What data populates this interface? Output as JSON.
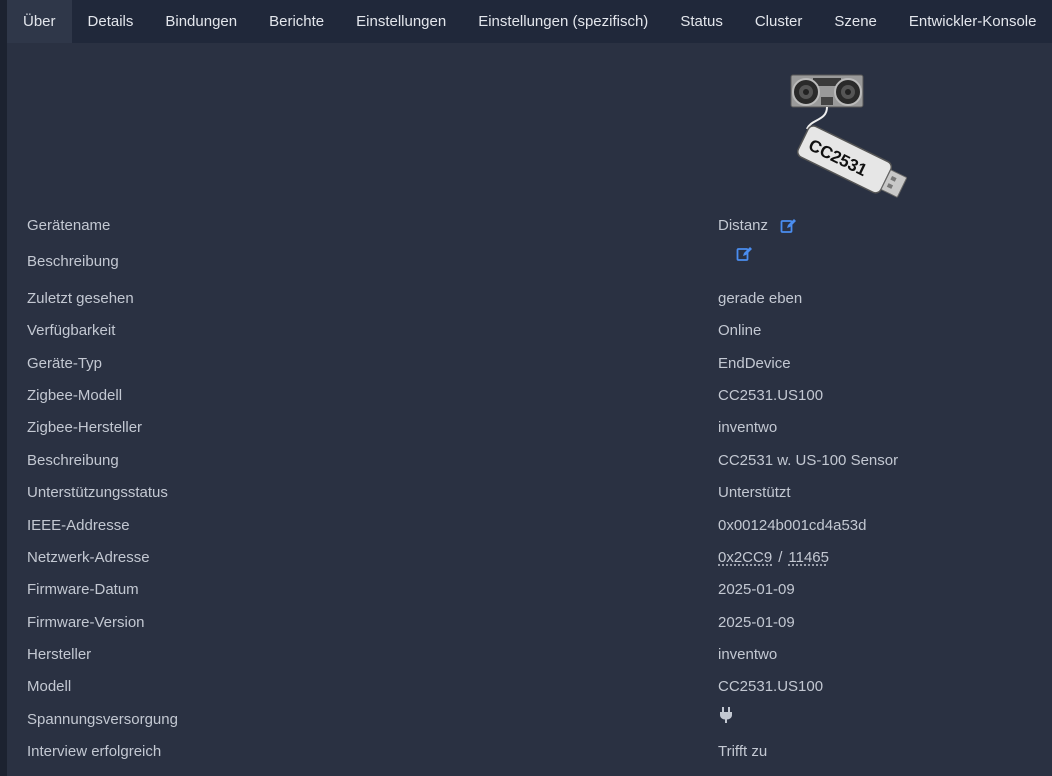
{
  "tabs": [
    {
      "label": "Über",
      "active": true
    },
    {
      "label": "Details"
    },
    {
      "label": "Bindungen"
    },
    {
      "label": "Berichte"
    },
    {
      "label": "Einstellungen"
    },
    {
      "label": "Einstellungen (spezifisch)"
    },
    {
      "label": "Status"
    },
    {
      "label": "Cluster"
    },
    {
      "label": "Szene"
    },
    {
      "label": "Entwickler-Konsole"
    }
  ],
  "device_image": {
    "label_text": "CC2531"
  },
  "rows": {
    "device_name": {
      "label": "Gerätename",
      "value": "Distanz"
    },
    "description_edit": {
      "label": "Beschreibung",
      "value": ""
    },
    "last_seen": {
      "label": "Zuletzt gesehen",
      "value": "gerade eben"
    },
    "availability": {
      "label": "Verfügbarkeit",
      "value": "Online"
    },
    "device_type": {
      "label": "Geräte-Typ",
      "value": "EndDevice"
    },
    "zigbee_model": {
      "label": "Zigbee-Modell",
      "value": "CC2531.US100"
    },
    "zigbee_manufacturer": {
      "label": "Zigbee-Hersteller",
      "value": "inventwo"
    },
    "description": {
      "label": "Beschreibung",
      "value": "CC2531 w. US-100 Sensor"
    },
    "support_status": {
      "label": "Unterstützungsstatus",
      "value": "Unterstützt"
    },
    "ieee_address": {
      "label": "IEEE-Addresse",
      "value": "0x00124b001cd4a53d"
    },
    "network_address": {
      "label": "Netzwerk-Adresse",
      "hex": "0x2CC9",
      "separator": "/",
      "dec": "11465"
    },
    "firmware_date": {
      "label": "Firmware-Datum",
      "value": "2025-01-09"
    },
    "firmware_version": {
      "label": "Firmware-Version",
      "value": "2025-01-09"
    },
    "manufacturer": {
      "label": "Hersteller",
      "value": "inventwo"
    },
    "model": {
      "label": "Modell",
      "value": "CC2531.US100"
    },
    "power_source": {
      "label": "Spannungsversorgung",
      "icon": "plug-icon"
    },
    "interview": {
      "label": "Interview erfolgreich",
      "value": "Trifft zu"
    }
  },
  "colors": {
    "background": "#2a3142",
    "tabbar": "#20283a",
    "link": "#4a8df0",
    "success": "#41b86a"
  }
}
